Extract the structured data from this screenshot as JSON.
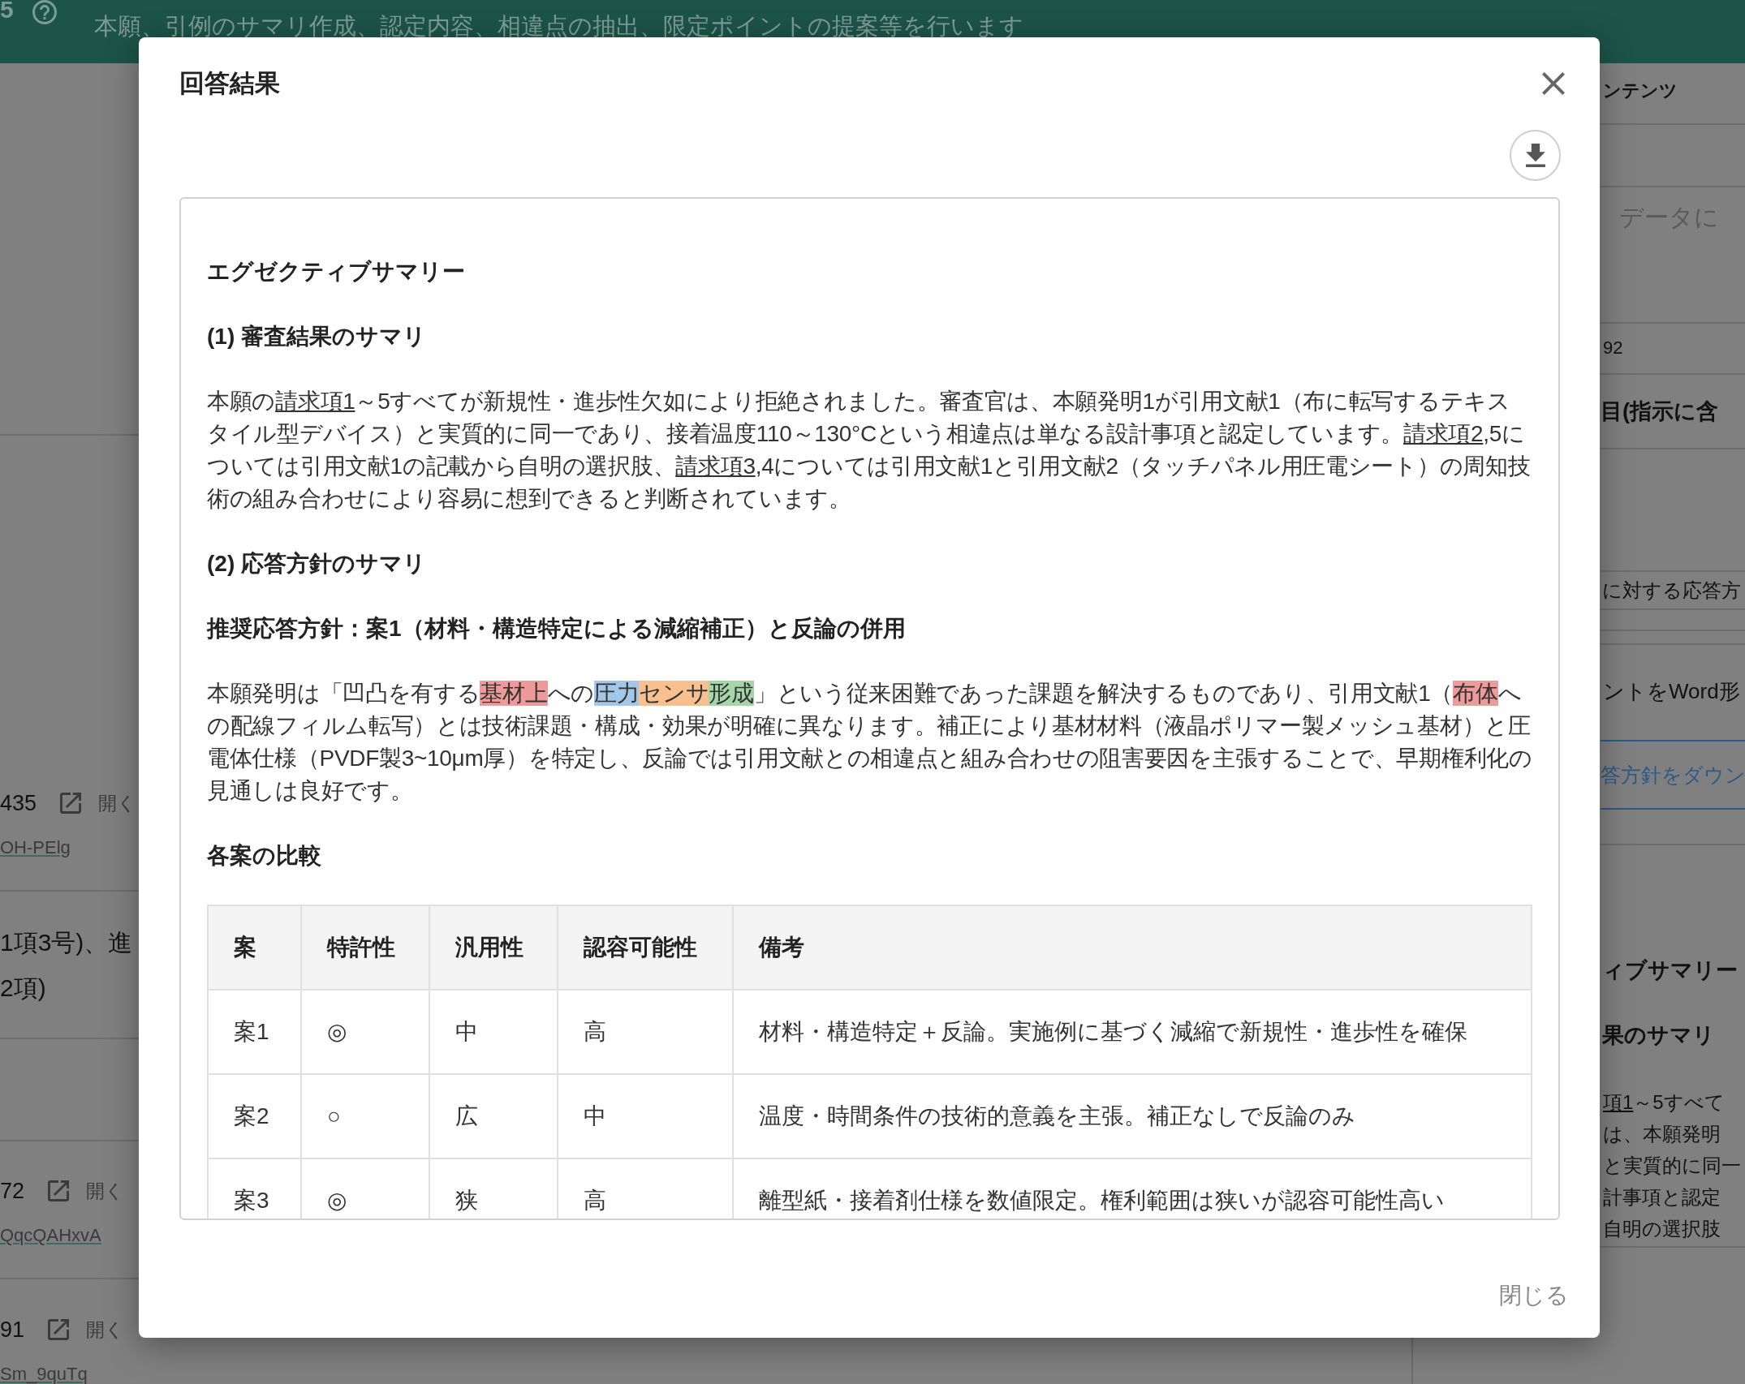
{
  "page_header": {
    "section_number": "5",
    "description": "本願、引例のサマリ作成、認定内容、相違点の抽出、限定ポイントの提案等を行います"
  },
  "left_panel": {
    "rows": [
      {
        "kind": "reference",
        "number": "435",
        "open_label": "開く",
        "link": "OH-PElg"
      },
      {
        "kind": "text",
        "lines": [
          "1項3号)、進",
          "2項)"
        ]
      },
      {
        "kind": "reference",
        "number": "72",
        "open_label": "開く",
        "link": "QqcQAHxvA"
      },
      {
        "kind": "reference",
        "number": "91",
        "open_label": "開く",
        "link": "Sm_9quTq"
      }
    ]
  },
  "right_panel": {
    "title": "ンテンツ",
    "textarea": {
      "placeholder": "データに"
    },
    "count": "92",
    "field_label": "目(指示に含",
    "input": {
      "value": "に対する応答方"
    },
    "option_label": "ントをWord形",
    "download_button": {
      "label": "答方針をダウン"
    },
    "preview": {
      "heading": "ィブサマリー",
      "subheading": "果のサマリ",
      "lines": [
        {
          "segments": [
            {
              "kind": "link",
              "text": "項1"
            },
            {
              "kind": "plain",
              "text": "～5すべて"
            }
          ]
        },
        {
          "segments": [
            {
              "kind": "plain",
              "text": "は、本願発明"
            }
          ]
        },
        {
          "segments": [
            {
              "kind": "plain",
              "text": "と実質的に同一"
            }
          ]
        },
        {
          "segments": [
            {
              "kind": "plain",
              "text": "計事項と認定"
            }
          ]
        },
        {
          "segments": [
            {
              "kind": "plain",
              "text": "自明の選択肢"
            }
          ]
        }
      ]
    }
  },
  "dialog": {
    "title": "回答結果",
    "document": {
      "blocks": [
        {
          "kind": "heading",
          "text": "エグゼクティブサマリー"
        },
        {
          "kind": "heading",
          "text": "(1) 審査結果のサマリ"
        },
        {
          "kind": "paragraph",
          "segments": [
            {
              "kind": "plain",
              "text": "本願の"
            },
            {
              "kind": "link",
              "text": "請求項1"
            },
            {
              "kind": "plain",
              "text": "～5すべてが新規性・進歩性欠如により拒絶されました。審査官は、本願発明1が引用文献1（布に転写するテキスタイル型デバイス）と実質的に同一であり、接着温度110～130°Cという相違点は単なる設計事項と認定しています。"
            },
            {
              "kind": "link",
              "text": "請求項2"
            },
            {
              "kind": "plain",
              "text": ",5については引用文献1の記載から自明の選択肢、"
            },
            {
              "kind": "link",
              "text": "請求項3"
            },
            {
              "kind": "plain",
              "text": ",4については引用文献1と引用文献2（タッチパネル用圧電シート）の周知技術の組み合わせにより容易に想到できると判断されています。"
            }
          ]
        },
        {
          "kind": "heading",
          "text": "(2) 応答方針のサマリ"
        },
        {
          "kind": "heading",
          "text": "推奨応答方針：案1（材料・構造特定による減縮補正）と反論の併用"
        },
        {
          "kind": "paragraph",
          "segments": [
            {
              "kind": "plain",
              "text": "本願発明は「凹凸を有する"
            },
            {
              "kind": "highlight",
              "text": "基材上",
              "color": "#ef9a9a"
            },
            {
              "kind": "plain",
              "text": "への"
            },
            {
              "kind": "highlight",
              "text": "圧力",
              "color": "#a3c7e8"
            },
            {
              "kind": "highlight",
              "text": "センサ",
              "color": "#f9c08f"
            },
            {
              "kind": "highlight",
              "text": "形成",
              "color": "#a5d6a7"
            },
            {
              "kind": "plain",
              "text": "」という従来困難であった課題を解決するものであり、引用文献1（"
            },
            {
              "kind": "highlight",
              "text": "布体",
              "color": "#ef9a9a"
            },
            {
              "kind": "plain",
              "text": "への配線フィルム転写）とは技術課題・構成・効果が明確に異なります。補正により基材材料（液晶ポリマー製メッシュ基材）と圧電体仕様（PVDF製3~10μm厚）を特定し、反論では引用文献との相違点と組み合わせの阻害要因を主張することで、早期権利化の見通しは良好です。"
            }
          ]
        },
        {
          "kind": "heading",
          "text": "各案の比較"
        },
        {
          "kind": "table",
          "columns": [
            "案",
            "特許性",
            "汎用性",
            "認容可能性",
            "備考"
          ],
          "rows": [
            [
              "案1",
              "◎",
              "中",
              "高",
              "材料・構造特定＋反論。実施例に基づく減縮で新規性・進歩性を確保"
            ],
            [
              "案2",
              "○",
              "広",
              "中",
              "温度・時間条件の技術的意義を主張。補正なしで反論のみ"
            ],
            [
              "案3",
              "◎",
              "狭",
              "高",
              "離型紙・接着剤仕様を数値限定。権利範囲は狭いが認容可能性高い"
            ]
          ]
        }
      ]
    },
    "close_label": "閉じる"
  }
}
